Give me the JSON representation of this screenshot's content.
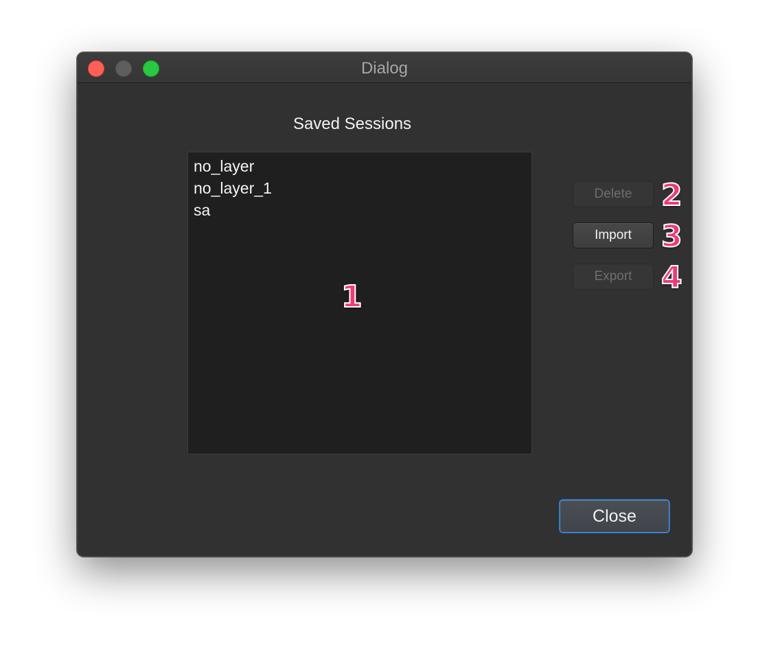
{
  "window": {
    "title": "Dialog"
  },
  "sessions": {
    "heading": "Saved Sessions",
    "items": [
      "no_layer",
      "no_layer_1",
      "sa"
    ]
  },
  "buttons": {
    "delete_label": "Delete",
    "import_label": "Import",
    "export_label": "Export",
    "close_label": "Close"
  },
  "callouts": {
    "list": "1",
    "delete": "2",
    "import": "3",
    "export": "4"
  },
  "colors": {
    "accent": "#4a8fd9",
    "callout": "#ee3b78",
    "window_bg": "#313131",
    "list_bg": "#1f1f1f"
  }
}
